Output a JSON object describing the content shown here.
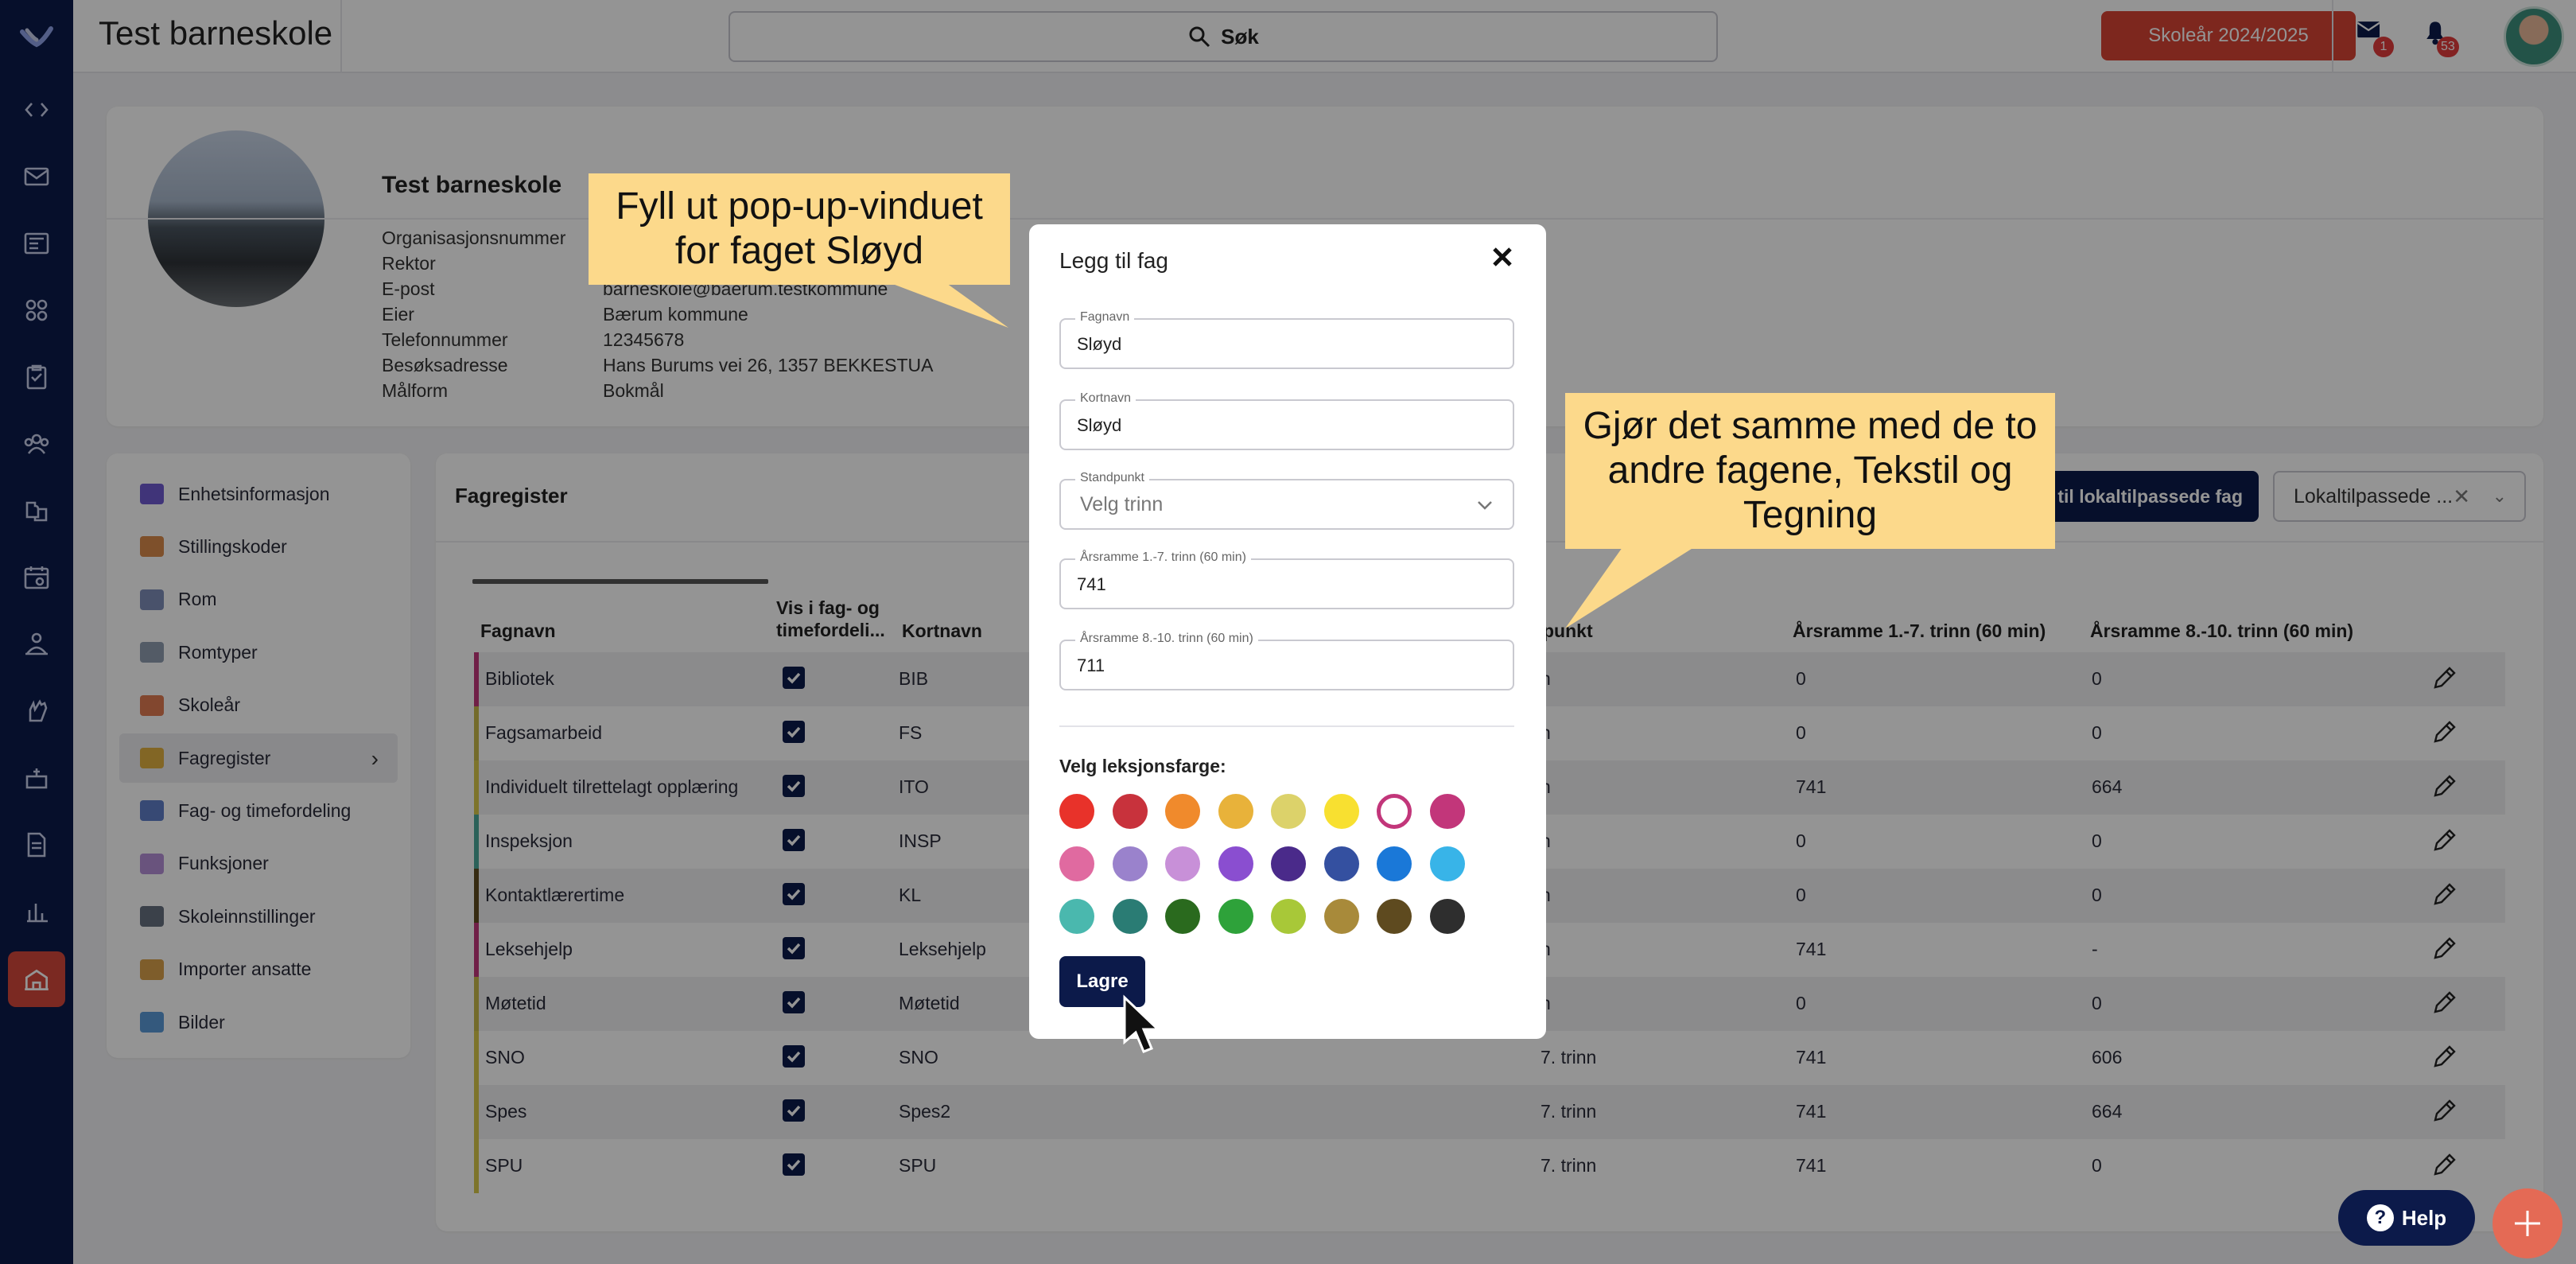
{
  "app": {
    "title": "Test barneskole"
  },
  "search": {
    "label": "Søk"
  },
  "topbar": {
    "school_year": "Skoleår 2024/2025",
    "mail_badge": "1",
    "bell_badge": "53"
  },
  "school": {
    "name": "Test barneskole",
    "info": [
      {
        "label": "Organisasjonsnummer",
        "value": ""
      },
      {
        "label": "Rektor",
        "value": ""
      },
      {
        "label": "E-post",
        "value": "barneskole@baerum.testkommune"
      },
      {
        "label": "Eier",
        "value": "Bærum kommune"
      },
      {
        "label": "Telefonnummer",
        "value": "12345678"
      },
      {
        "label": "Besøksadresse",
        "value": "Hans Burums vei 26, 1357 BEKKESTUA"
      },
      {
        "label": "Målform",
        "value": "Bokmål"
      }
    ]
  },
  "nav": {
    "items": [
      {
        "label": "Enhetsinformasjon",
        "color": "#6f5bd1"
      },
      {
        "label": "Stillingskoder",
        "color": "#d98b4a"
      },
      {
        "label": "Rom",
        "color": "#7f8db8"
      },
      {
        "label": "Romtyper",
        "color": "#8f9db0"
      },
      {
        "label": "Skoleår",
        "color": "#e07a52"
      },
      {
        "label": "Fagregister",
        "color": "#e0b040"
      },
      {
        "label": "Fag- og timefordeling",
        "color": "#5f7fc8"
      },
      {
        "label": "Funksjoner",
        "color": "#b58fd8"
      },
      {
        "label": "Skoleinnstillinger",
        "color": "#667080"
      },
      {
        "label": "Importer ansatte",
        "color": "#d9a04a"
      },
      {
        "label": "Bilder",
        "color": "#5b9ad8"
      }
    ]
  },
  "register": {
    "title": "Fagregister",
    "add_local_label": "til lokaltilpassede fag",
    "local_filter": "Lokaltilpassede ...",
    "columns": {
      "name": "Fagnavn",
      "visible": "Vis i fag- og timefordeli...",
      "short": "Kortnavn",
      "standpoint": "punkt",
      "frame17": "Årsramme 1.-7. trinn (60 min)",
      "frame810": "Årsramme 8.-10. trinn (60 min)"
    },
    "rows": [
      {
        "name": "Bibliotek",
        "short": "BIB",
        "standpoint": "n",
        "f17": "0",
        "f810": "0",
        "bar": "#c2367a"
      },
      {
        "name": "Fagsamarbeid",
        "short": "FS",
        "standpoint": "n",
        "f17": "0",
        "f810": "0",
        "bar": "#c7b84b"
      },
      {
        "name": "Individuelt tilrettelagt opplæring",
        "short": "ITO",
        "standpoint": "n",
        "f17": "741",
        "f810": "664",
        "bar": "#d8c94a"
      },
      {
        "name": "Inspeksjon",
        "short": "INSP",
        "standpoint": "n",
        "f17": "0",
        "f810": "0",
        "bar": "#4aa89a"
      },
      {
        "name": "Kontaktlærertime",
        "short": "KL",
        "standpoint": "n",
        "f17": "0",
        "f810": "0",
        "bar": "#5e4a1f"
      },
      {
        "name": "Leksehjelp",
        "short": "Leksehjelp",
        "standpoint": "n",
        "f17": "741",
        "f810": "-",
        "bar": "#c2367a"
      },
      {
        "name": "Møtetid",
        "short": "Møtetid",
        "standpoint": "n",
        "f17": "0",
        "f810": "0",
        "bar": "#c7b84b"
      },
      {
        "name": "SNO",
        "short": "SNO",
        "standpoint": "7. trinn",
        "f17": "741",
        "f810": "606",
        "bar": "#d8c94a"
      },
      {
        "name": "Spes",
        "short": "Spes2",
        "standpoint": "7. trinn",
        "f17": "741",
        "f810": "664",
        "bar": "#d8c94a"
      },
      {
        "name": "SPU",
        "short": "SPU",
        "standpoint": "7. trinn",
        "f17": "741",
        "f810": "0",
        "bar": "#d8c94a"
      }
    ]
  },
  "modal": {
    "title": "Legg til fag",
    "fields": {
      "fagnavn": {
        "label": "Fagnavn",
        "value": "Sløyd"
      },
      "kortnavn": {
        "label": "Kortnavn",
        "value": "Sløyd"
      },
      "standpunkt": {
        "label": "Standpunkt",
        "value": "Velg trinn"
      },
      "frame17": {
        "label": "Årsramme 1.-7. trinn (60 min)",
        "value": "741"
      },
      "frame810": {
        "label": "Årsramme 8.-10. trinn (60 min)",
        "value": "711"
      }
    },
    "color_label": "Velg leksjonsfarge:",
    "colors": [
      "#e8322a",
      "#c8323c",
      "#f08a2c",
      "#e8b23a",
      "#dcd26a",
      "#f8e030",
      "#ffffff",
      "#c2367a",
      "#e06aa0",
      "#9a82cc",
      "#c890d8",
      "#8a4ed0",
      "#4a2a8a",
      "#3450a0",
      "#1a78d8",
      "#38b4e8",
      "#4ab8ae",
      "#2a7c74",
      "#2a6a1e",
      "#2ea23a",
      "#a8c838",
      "#a88a3a",
      "#5e4a1f",
      "#2e2e2e"
    ],
    "selected_color_index": 6,
    "save_label": "Lagre"
  },
  "callouts": {
    "first": "Fyll ut pop-up-vinduet for faget Sløyd",
    "second": "Gjør det samme med de to andre fagene, Tekstil og Tegning"
  },
  "help": {
    "label": "Help"
  }
}
